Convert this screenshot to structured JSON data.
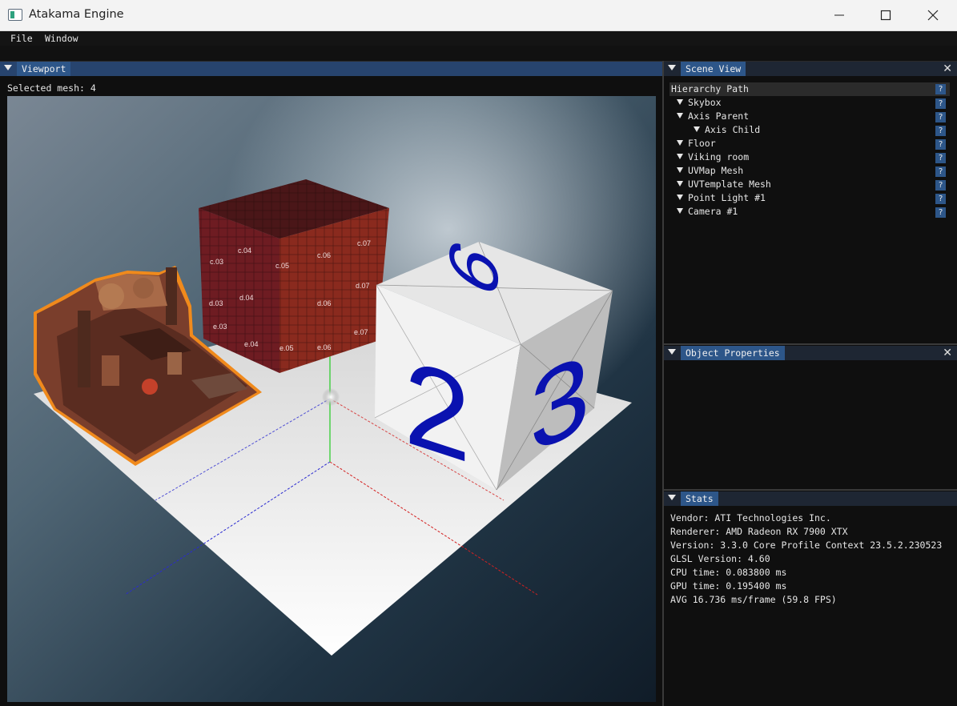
{
  "window": {
    "title": "Atakama Engine"
  },
  "menu": {
    "file": "File",
    "window": "Window"
  },
  "viewport": {
    "tab": "Viewport",
    "selected_mesh": "Selected mesh: 4",
    "cube_numbers": {
      "top": "6",
      "front": "2",
      "right": "3"
    },
    "uv_labels": [
      "c.03",
      "c.04",
      "c.05",
      "c.06",
      "c.07",
      "d.03",
      "d.04",
      "d.06",
      "d.07",
      "e.03",
      "e.04",
      "e.05",
      "e.06",
      "e.07"
    ]
  },
  "scene_view": {
    "tab": "Scene View",
    "header": "Hierarchy Path",
    "items": [
      {
        "label": "Skybox"
      },
      {
        "label": "Axis Parent"
      },
      {
        "label": "Axis Child"
      },
      {
        "label": "Floor"
      },
      {
        "label": "Viking room"
      },
      {
        "label": "UVMap Mesh"
      },
      {
        "label": "UVTemplate Mesh"
      },
      {
        "label": "Point Light #1"
      },
      {
        "label": "Camera #1"
      }
    ],
    "help_glyph": "?"
  },
  "object_properties": {
    "tab": "Object Properties"
  },
  "stats": {
    "tab": "Stats",
    "vendor": "Vendor: ATI Technologies Inc.",
    "renderer": "Renderer: AMD Radeon RX 7900 XTX",
    "version": "Version: 3.3.0 Core Profile Context 23.5.2.230523",
    "glsl": "GLSL Version: 4.60",
    "cpu": "CPU time: 0.083800 ms",
    "gpu": "GPU time: 0.195400 ms",
    "avg": "AVG 16.736 ms/frame (59.8 FPS)"
  },
  "colors": {
    "accent": "#2d5689",
    "selection_outline": "#f08a1c",
    "axis_x": "#d42020",
    "axis_y": "#22cc22",
    "axis_z": "#2222cc",
    "dice_number": "#0a12b0"
  }
}
